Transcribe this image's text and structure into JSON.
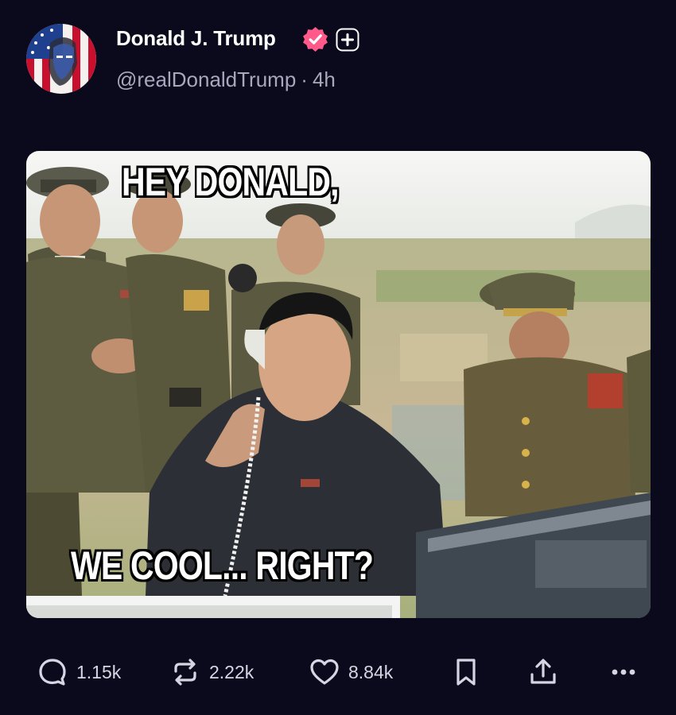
{
  "post": {
    "author": {
      "display_name": "Donald J. Trump",
      "handle": "@realDonaldTrump",
      "time_ago": "4h",
      "separator": "·",
      "verified_icon": "verified-badge-icon",
      "follow_icon": "plus-icon",
      "verified_color": "#ff5a8a"
    },
    "media": {
      "caption_top": "HEY DONALD,",
      "caption_bottom": "WE COOL... RIGHT?"
    },
    "actions": {
      "replies": "1.15k",
      "reposts": "2.22k",
      "likes": "8.84k"
    }
  },
  "colors": {
    "background": "#0b0a1c",
    "secondary_text": "#a9a6bd",
    "icon": "#d7d5e3"
  }
}
